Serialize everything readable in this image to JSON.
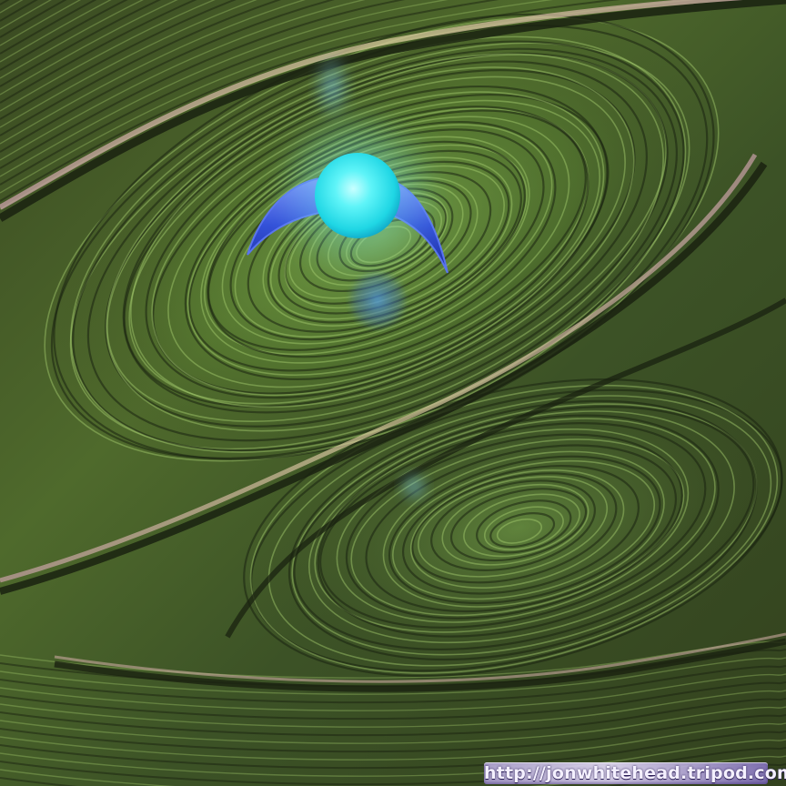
{
  "artwork": {
    "watermark_text": "http://jonwhitehead.tripod.com",
    "palette": {
      "field_dark": "#2e3b1b",
      "field_mid": "#4f6a2c",
      "field_light": "#7ea34a",
      "ridge_highlight": "#a8d070",
      "band_gold": "#c8b888",
      "band_pink": "#c9a0a8",
      "groove_dark": "#1a2210",
      "orb": "#33e8f0",
      "orb_core": "#b8ffff",
      "crescent": "#3c5fe0",
      "flare": "#3f86d6"
    }
  }
}
